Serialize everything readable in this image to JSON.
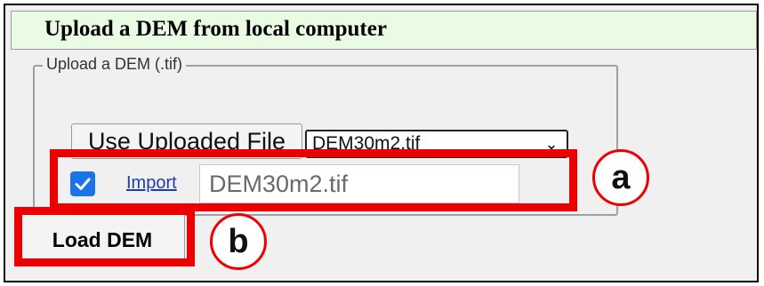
{
  "panel": {
    "header_title": "Upload a DEM from local computer"
  },
  "upload_group": {
    "legend": "Upload a DEM (.tif)",
    "use_uploaded_button": "Use Uploaded File",
    "selected_file": "DEM30m2.tif",
    "chevron_glyph": "⌄",
    "import_checked": true,
    "checkbox_icon": "checkmark-icon",
    "import_link": "Import",
    "import_value": "DEM30m2.tif"
  },
  "load_button": "Load DEM",
  "annotations": {
    "a": "a",
    "b": "b",
    "highlight_color": "#ee0000"
  }
}
